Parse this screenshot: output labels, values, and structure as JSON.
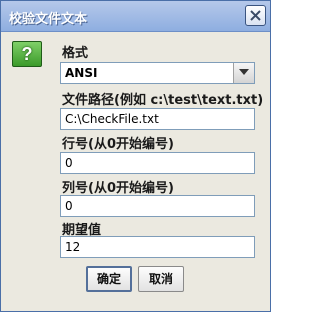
{
  "window": {
    "title": "校验文件文本",
    "close_icon": "close-icon",
    "question_icon": "question-icon"
  },
  "form": {
    "format_label": "格式",
    "format_value": "ANSI",
    "path_label": "文件路径(例如 c:\\test\\text.txt)",
    "path_value": "C:\\CheckFile.txt",
    "line_label": "行号(从0开始编号)",
    "line_value": "0",
    "col_label": "列号(从0开始编号)",
    "col_value": "0",
    "expected_label": "期望值",
    "expected_value": "12"
  },
  "buttons": {
    "ok": "确定",
    "cancel": "取消"
  },
  "colors": {
    "titlebar": "#8eaee0",
    "icon_green": "#3b9a2a"
  }
}
